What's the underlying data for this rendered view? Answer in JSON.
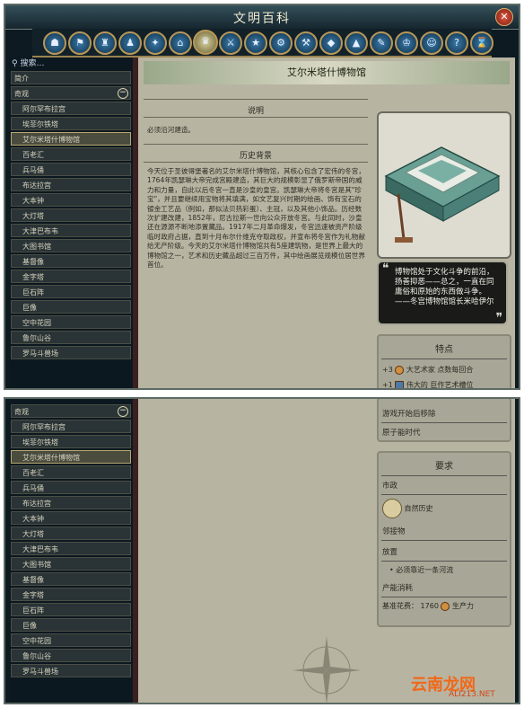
{
  "window": {
    "title": "文明百科",
    "close_icon": "close-icon"
  },
  "categories": [
    "history",
    "civilizations",
    "city_states",
    "great_people",
    "religion",
    "buildings",
    "wonders",
    "units",
    "promotions",
    "technologies",
    "improvements",
    "resources",
    "terrain",
    "policies",
    "governments",
    "specialists",
    "concepts",
    "eras",
    "misc"
  ],
  "sidebar": {
    "search_label": "搜索…",
    "top_items": [
      "简介",
      "奇观",
      "阿尔罕布拉宫",
      "埃菲尔铁塔",
      "艾尔米塔什博物馆",
      "百老汇",
      "兵马俑",
      "布达拉宫",
      "大本钟",
      "大灯塔",
      "大津巴布韦",
      "大图书馆",
      "基督像",
      "金字塔",
      "巨石阵",
      "巨像",
      "空中花园",
      "鲁尔山谷",
      "罗马斗兽场"
    ],
    "bottom_items": [
      "奇观",
      "阿尔罕布拉宫",
      "埃菲尔铁塔",
      "艾尔米塔什博物馆",
      "百老汇",
      "兵马俑",
      "布达拉宫",
      "大本钟",
      "大灯塔",
      "大津巴布韦",
      "大图书馆",
      "基督像",
      "金字塔",
      "巨石阵",
      "巨像",
      "空中花园",
      "鲁尔山谷",
      "罗马斗兽场"
    ]
  },
  "content": {
    "title": "艾尔米塔什博物馆",
    "desc_heading": "说明",
    "desc_text": "必须沿河建造。",
    "history_heading": "历史背景",
    "history_text": "今天位于圣彼得堡著名的艾尔米塔什博物馆，其核心包含了宏伟的冬宫，1764年凯瑟琳大帝完成宫殿建造，其巨大的规模彰显了俄罗斯帝国的威力和力量，自此以后冬宫一直是沙皇的皇宫。凯瑟琳大帝将冬宫是其\"珍宝\"，并且要继续用宝物将其填满，如文艺复兴时期的绘画、饰有宝石的镀金工艺品（例如，那似法贝热彩蛋）、主冠，以及其他小饰品。历经数次扩建改建，1852年，尼古拉斯一世向公众开放冬宫。与此同时，沙皇还在源源不断地添置藏品。1917年二月革命爆发，冬宫迅速被资产阶级临时政府占据，直到十月布尔什维克夺取政权，并宣布将冬宫作为礼物献给无产阶级。今天的艾尔米塔什博物馆共有5座建筑物，是世界上最大的博物馆之一，艺术和历史藏品超过三百万件，其中绘画展览规模位居世界首位。",
    "quote": "博物馆处于文化斗争的前沿，扬善抑恶——总之，一直在同庸俗和原始的东西做斗争。——冬宫博物馆馆长米哈伊尔",
    "traits": {
      "heading": "特点",
      "line1": "+3",
      "line1_text": "大艺术家 点数每回合",
      "line2": "+1",
      "line2_text": "伟大的 巨作艺术槽位"
    },
    "obsolete": {
      "label": "游戏开始后移除",
      "value": "原子能时代"
    },
    "requirements": {
      "heading": "要求",
      "civic_label": "市政",
      "civic_value": "自然历史",
      "adjacent_label": "邻接物",
      "placement_label": "放置",
      "placement_value": "必须靠近一条河流",
      "cost_label": "产能消耗",
      "base_cost": "基准花费：",
      "base_cost_value": "1760",
      "production": "生产力"
    }
  },
  "watermark": {
    "brand": "云南龙网",
    "site": "ALI213.NET"
  },
  "colors": {
    "banner": "#d8d8c4",
    "selected_border": "#b8a870",
    "brand": "#f06818"
  }
}
